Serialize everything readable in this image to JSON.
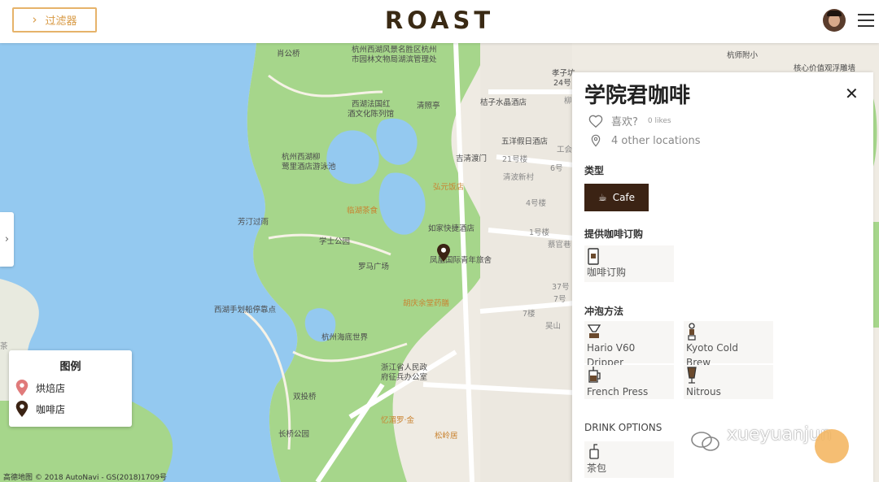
{
  "header": {
    "filter_label": "过滤器",
    "brand": "ROAST"
  },
  "map": {
    "pois": [
      "肖公桥",
      "杭州西湖风景名胜区杭州",
      "市园林文物局湖滨管理处",
      "西湖法国红",
      "酒文化陈列馆",
      "清照亭",
      "杭州西湖柳",
      "莺里酒店游泳池",
      "孝子坊",
      "24号",
      "桔子水晶酒店",
      "五洋假日酒店",
      "吉清渡门",
      "弘元饭店",
      "清波新村",
      "芳汀过雨",
      "临湖茶食",
      "如家快捷酒店",
      "学士公园",
      "罗马广场",
      "凤凰国际青年旅舍",
      "胡庆余堂药膳",
      "西湖手划船停靠点",
      "杭州海底世界",
      "浙江省人民政",
      "府征兵办公室",
      "双投桥",
      "忆湄罗·金",
      "长桥公园",
      "松岭居",
      "杭师附小",
      "核心价值观浮雕墙",
      "21号楼",
      "6号",
      "4号楼",
      "1号楼",
      "7号",
      "37号",
      "7楼",
      "蔡官巷",
      "吴山",
      "工会",
      "柳",
      "茶"
    ],
    "attribution": "高德地图 © 2018 AutoNavi - GS(2018)1709号"
  },
  "legend": {
    "title": "图例",
    "items": [
      {
        "label": "烘焙店",
        "color": "#e07a7a"
      },
      {
        "label": "咖啡店",
        "color": "#3b2314"
      }
    ]
  },
  "panel": {
    "title": "学院君咖啡",
    "likes_label": "喜欢?",
    "likes_count": "0 likes",
    "locations": "4 other locations",
    "type_heading": "类型",
    "type_value": "Cafe",
    "subscription_heading": "提供咖啡订购",
    "subscription_item": "咖啡订购",
    "brew_heading": "冲泡方法",
    "brew_methods": [
      {
        "line1": "Hario V60",
        "line2": "Dripper"
      },
      {
        "line1": "Kyoto Cold",
        "line2": "Brew"
      },
      {
        "line1": "French Press",
        "line2": ""
      },
      {
        "line1": "Nitrous",
        "line2": ""
      }
    ],
    "drink_heading": "DRINK OPTIONS",
    "drink_item": "茶包"
  },
  "watermark": "xueyuanjun",
  "colors": {
    "accent": "#e6b36a",
    "brand": "#3a2a14",
    "cafe_button": "#3b2314",
    "water": "#94c9f0",
    "park": "#a6d68b"
  }
}
